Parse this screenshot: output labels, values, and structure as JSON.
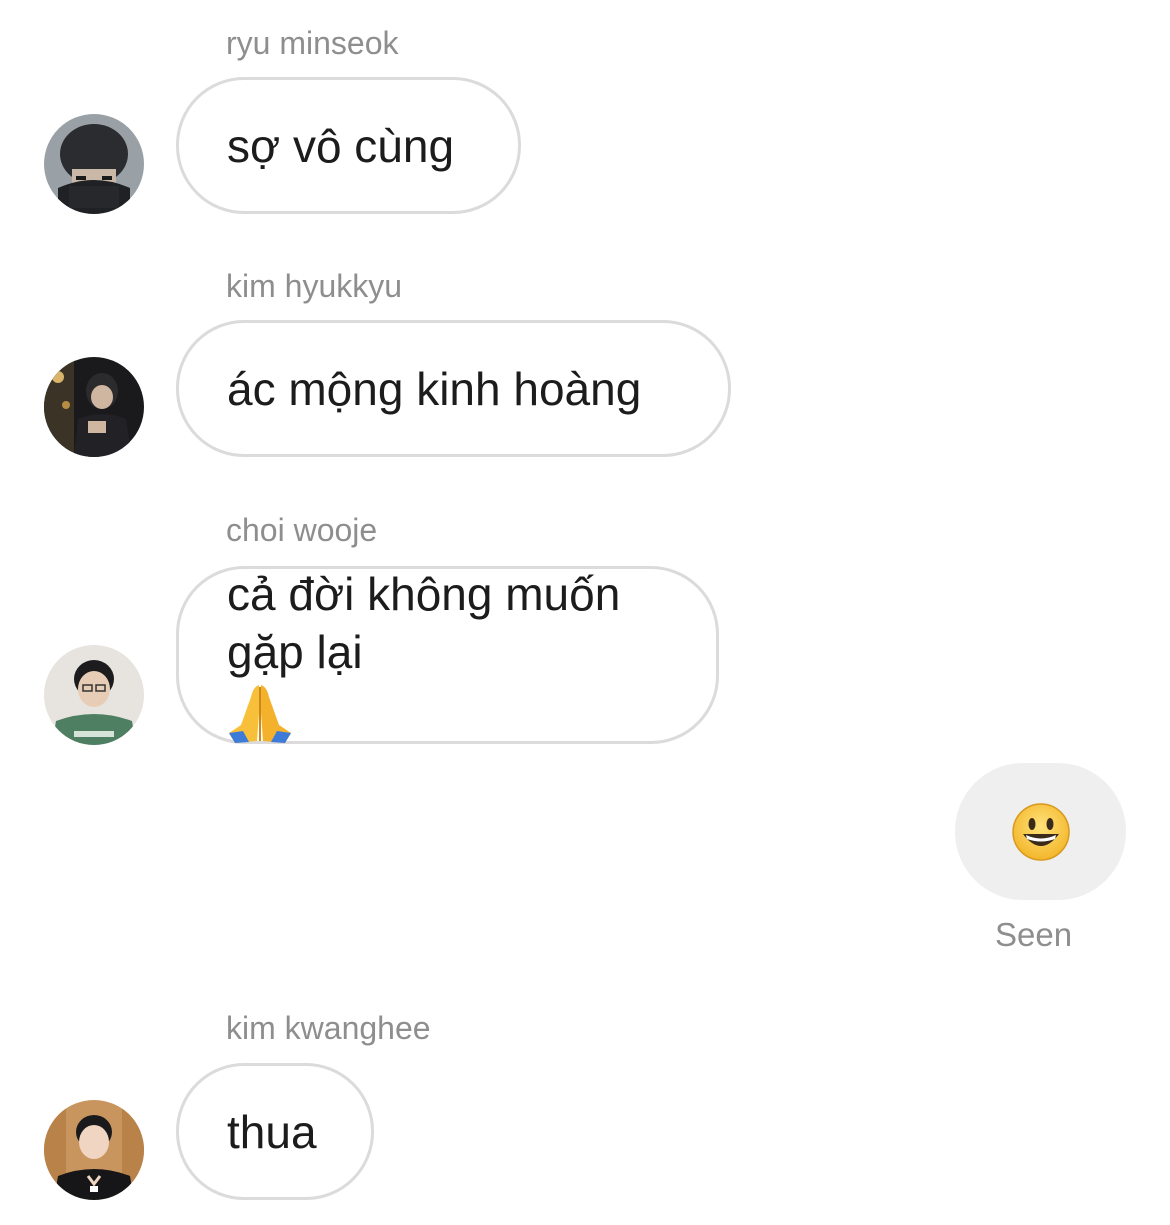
{
  "messages": [
    {
      "sender": "ryu minseok",
      "text": "sợ vô cùng",
      "avatar": "avatar-ryu-minseok"
    },
    {
      "sender": "kim hyukkyu",
      "text": "ác mộng kinh hoàng",
      "avatar": "avatar-kim-hyukkyu"
    },
    {
      "sender": "choi wooje",
      "text": "cả đời không muốn\ngặp lại",
      "emoji": "folded-hands-emoji",
      "avatar": "avatar-choi-wooje"
    },
    {
      "sender": "kim kwanghee",
      "text": "thua",
      "avatar": "avatar-kim-kwanghee"
    }
  ],
  "own_message": {
    "emoji": "grinning-face-emoji"
  },
  "status": {
    "seen_label": "Seen"
  },
  "colors": {
    "bubble_border": "#dbdbdb",
    "own_bubble_bg": "#efefef",
    "meta_text": "#8e8e8e",
    "message_text": "#1c1c1c"
  }
}
